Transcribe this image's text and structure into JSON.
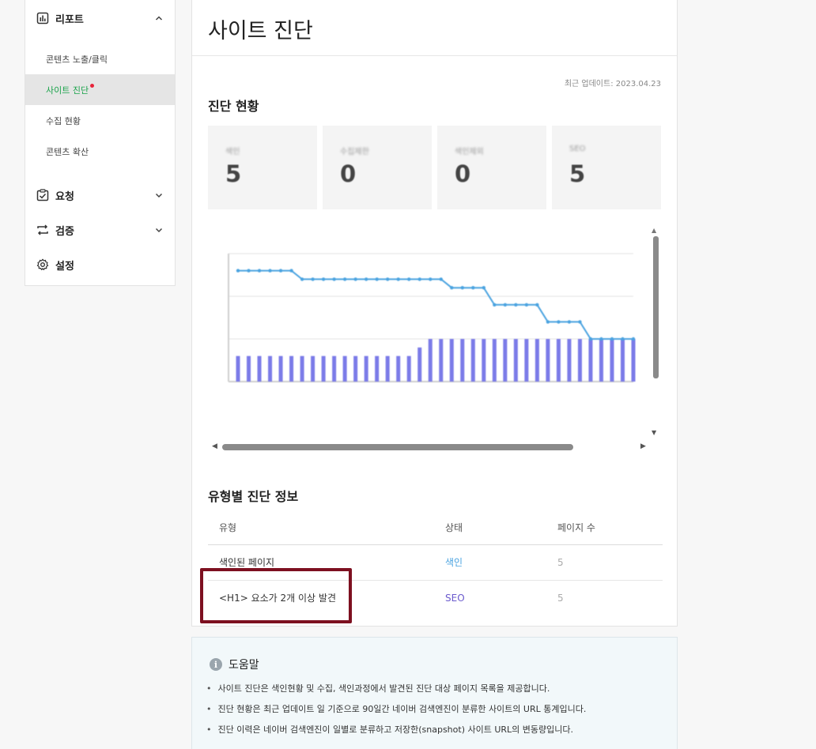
{
  "sidebar": {
    "groups": [
      {
        "label": "리포트",
        "icon": "bar-chart-icon",
        "expanded": true
      },
      {
        "label": "요청",
        "icon": "checklist-icon",
        "expanded": false
      },
      {
        "label": "검증",
        "icon": "repeat-arrows-icon",
        "expanded": false
      },
      {
        "label": "설정",
        "icon": "gear-icon"
      }
    ],
    "report_items": [
      {
        "label": "콘텐츠 노출/클릭",
        "active": false
      },
      {
        "label": "사이트 진단",
        "active": true,
        "badge": true
      },
      {
        "label": "수집 현황",
        "active": false
      },
      {
        "label": "콘텐츠 확산",
        "active": false
      }
    ]
  },
  "main": {
    "title": "사이트 진단",
    "updated": "최근 업데이트: 2023.04.23",
    "status_title": "진단 현황",
    "stats": [
      {
        "label": "색인",
        "value": "5"
      },
      {
        "label": "수집제한",
        "value": "0"
      },
      {
        "label": "색인제외",
        "value": "0"
      },
      {
        "label": "SEO",
        "value": "5"
      }
    ],
    "type_title": "유형별 진단 정보",
    "table": {
      "headers": [
        "유형",
        "상태",
        "페이지 수"
      ],
      "rows": [
        {
          "type": "색인된 페이지",
          "status": "색인",
          "pages": "5"
        },
        {
          "type": "<H1> 요소가 2개 이상 발견",
          "status": "SEO",
          "pages": "5"
        }
      ]
    }
  },
  "help": {
    "title": "도움말",
    "items": [
      "사이트 진단은 색인현황 및 수집, 색인과정에서 발견된 진단 대상 페이지 목록을 제공합니다.",
      "진단 현황은 최근 업데이트 일 기준으로 90일간 네이버 검색엔진이 분류한 사이트의 URL 통계입니다.",
      "진단 이력은 네이버 검색엔진이 일별로 분류하고 저장한(snapshot) 사이트 URL의 변동량입니다."
    ]
  },
  "colors": {
    "active_green": "#1aa34a",
    "badge_red": "#e8243a",
    "line_blue": "#4aa3e0",
    "bar_purple": "#7b7be8",
    "highlight": "#7d1020"
  },
  "chart_data": {
    "type": "line",
    "ylim": [
      0,
      15
    ],
    "grid": true,
    "series": [
      {
        "type": "line",
        "values": [
          13,
          13,
          13,
          13,
          13,
          13,
          12,
          12,
          12,
          12,
          12,
          12,
          12,
          12,
          12,
          12,
          12,
          12,
          12,
          12,
          11,
          11,
          11,
          11,
          9,
          9,
          9,
          9,
          9,
          7,
          7,
          7,
          7,
          5,
          5,
          5,
          5,
          5
        ]
      },
      {
        "type": "bar",
        "values": [
          3,
          3,
          3,
          3,
          3,
          3,
          3,
          3,
          3,
          3,
          3,
          3,
          3,
          3,
          3,
          3,
          3,
          4,
          5,
          5,
          5,
          5,
          5,
          5,
          5,
          5,
          5,
          5,
          5,
          5,
          5,
          5,
          5,
          5,
          5,
          5,
          5,
          5
        ]
      }
    ]
  }
}
